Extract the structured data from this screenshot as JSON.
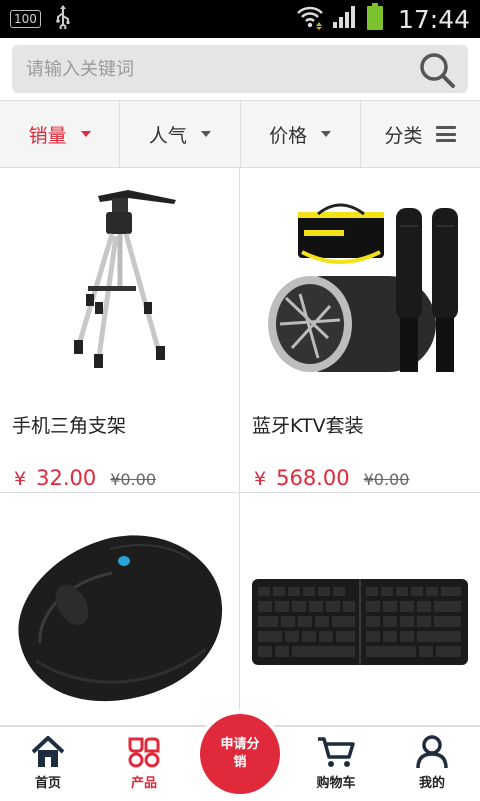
{
  "status_bar": {
    "battery_text": "100",
    "time": "17:44"
  },
  "search": {
    "placeholder": "请输入关键词"
  },
  "filters": [
    {
      "label": "销量",
      "active": true
    },
    {
      "label": "人气"
    },
    {
      "label": "价格"
    },
    {
      "label": "分类"
    }
  ],
  "products": [
    {
      "name": "手机三角支架",
      "currency": "¥",
      "price": "32.00",
      "old_price": "¥0.00",
      "image": "tripod"
    },
    {
      "name": "蓝牙KTV套装",
      "currency": "¥",
      "price": "568.00",
      "old_price": "¥0.00",
      "image": "ktv-speaker-microphones"
    },
    {
      "name": "",
      "image": "wireless-mouse"
    },
    {
      "name": "",
      "image": "folding-keyboard"
    }
  ],
  "tabbar": {
    "home": "首页",
    "products": "产品",
    "center": "申请分销",
    "cart": "购物车",
    "mine": "我的"
  },
  "colors": {
    "accent": "#e0293a",
    "text": "#222222",
    "search_bg": "#e5e5e5",
    "filter_bg": "#f5f5f5"
  }
}
